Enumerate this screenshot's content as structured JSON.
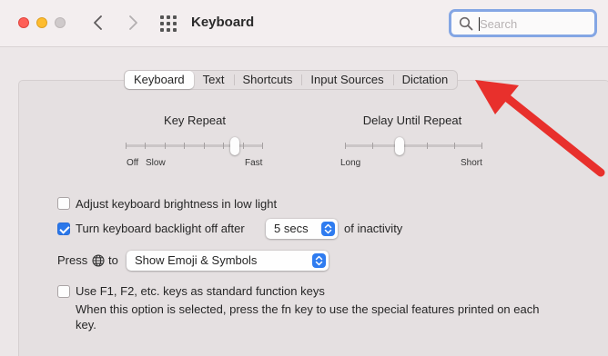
{
  "window": {
    "title": "Keyboard",
    "search_placeholder": "Search"
  },
  "tabs": [
    {
      "label": "Keyboard",
      "selected": true
    },
    {
      "label": "Text",
      "selected": false
    },
    {
      "label": "Shortcuts",
      "selected": false
    },
    {
      "label": "Input Sources",
      "selected": false
    },
    {
      "label": "Dictation",
      "selected": false
    }
  ],
  "key_repeat": {
    "label": "Key Repeat",
    "min_labels": [
      "Off",
      "Slow"
    ],
    "max_label": "Fast",
    "value_fraction": 0.8,
    "ticks": 8
  },
  "delay_until_repeat": {
    "label": "Delay Until Repeat",
    "min_label": "Long",
    "max_label": "Short",
    "value_fraction": 0.4,
    "ticks": 6
  },
  "options": {
    "brightness": {
      "label": "Adjust keyboard brightness in low light",
      "checked": false
    },
    "backlight": {
      "label": "Turn keyboard backlight off after",
      "checked": true,
      "value": "5 secs",
      "suffix": "of inactivity"
    },
    "press_globe": {
      "label_before": "Press",
      "label_after": "to",
      "value": "Show Emoji & Symbols"
    },
    "fn_keys": {
      "label": "Use F1, F2, etc. keys as standard function keys",
      "checked": false,
      "help": "When this option is selected, press the fn key to use the special features printed on each key."
    }
  },
  "colors": {
    "accent": "#2a77ea",
    "annotation_arrow": "#e8302c"
  }
}
